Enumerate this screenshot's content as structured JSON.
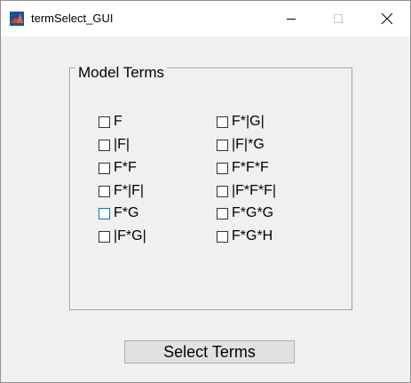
{
  "window": {
    "title": "termSelect_GUI",
    "icon": "matlab-icon",
    "controls": {
      "minimize": "minimize-icon",
      "maximize": "maximize-icon",
      "close": "close-icon"
    }
  },
  "panel": {
    "title": "Model Terms",
    "left_column": [
      {
        "label": "F",
        "checked": false
      },
      {
        "label": "|F|",
        "checked": false
      },
      {
        "label": "F*F",
        "checked": false
      },
      {
        "label": "F*|F|",
        "checked": false
      },
      {
        "label": "F*G",
        "checked": false,
        "focused": true
      },
      {
        "label": "|F*G|",
        "checked": false
      }
    ],
    "right_column": [
      {
        "label": "F*|G|",
        "checked": false
      },
      {
        "label": "|F|*G",
        "checked": false
      },
      {
        "label": "F*F*F",
        "checked": false
      },
      {
        "label": "|F*F*F|",
        "checked": false
      },
      {
        "label": "F*G*G",
        "checked": false
      },
      {
        "label": "F*G*H",
        "checked": false
      }
    ]
  },
  "actions": {
    "select_terms_label": "Select Terms"
  },
  "colors": {
    "background": "#f0f0f0",
    "titlebar": "#ffffff",
    "focus_border": "#0078d7",
    "button_face": "#e1e1e1"
  }
}
